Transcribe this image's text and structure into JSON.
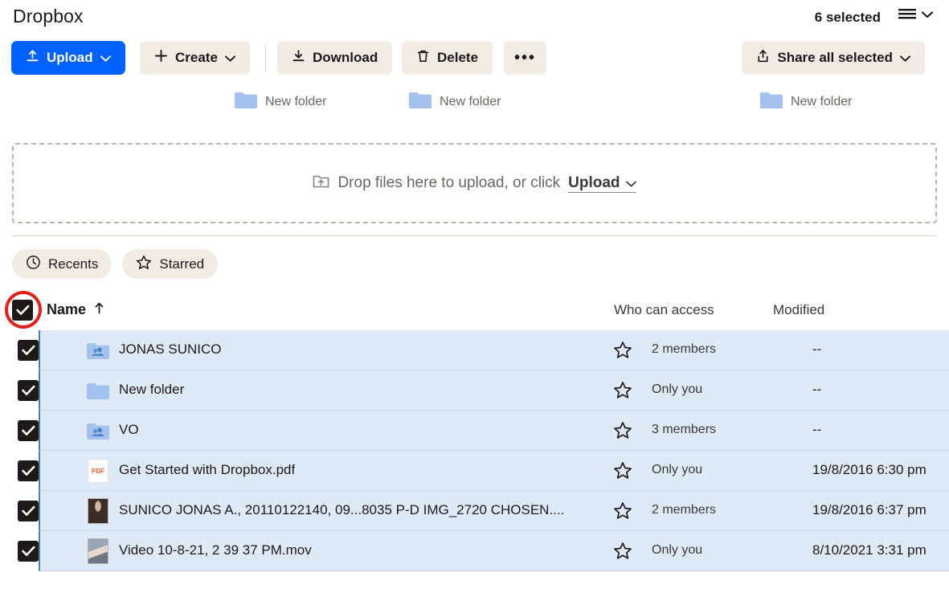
{
  "app": {
    "title": "Dropbox",
    "selected_label": "6 selected",
    "view_icon": "list-view-icon",
    "view_chevron": "chevron-down-icon"
  },
  "toolbar": {
    "upload": {
      "label": "Upload",
      "icon": "upload-icon",
      "chevron": "chevron-down-icon",
      "color": "#0061ff"
    },
    "create": {
      "label": "Create",
      "icon": "plus-icon",
      "chevron": "chevron-down-icon"
    },
    "download": {
      "label": "Download",
      "icon": "download-icon"
    },
    "delete": {
      "label": "Delete",
      "icon": "trash-icon"
    },
    "more": {
      "label": "•••",
      "icon": "ellipsis-icon"
    },
    "share_all": {
      "label": "Share all selected",
      "icon": "share-icon",
      "chevron": "chevron-down-icon"
    }
  },
  "suggestions": [
    {
      "label": "New folder",
      "icon": "folder-icon"
    },
    {
      "label": "New folder",
      "icon": "folder-icon"
    },
    {
      "label": "New folder",
      "icon": "folder-icon"
    }
  ],
  "dropzone": {
    "icon": "upload-folder-icon",
    "text_before": "Drop files here to upload, or click",
    "link_label": "Upload",
    "chevron": "chevron-down-icon"
  },
  "filters": [
    {
      "label": "Recents",
      "icon": "clock-icon"
    },
    {
      "label": "Starred",
      "icon": "star-icon"
    }
  ],
  "table": {
    "select_all_checked": true,
    "headers": {
      "name": "Name",
      "sort_arrow": "arrow-up-icon",
      "access": "Who can access",
      "modified": "Modified"
    },
    "rows": [
      {
        "name": "JONAS SUNICO",
        "icon": "shared-folder-icon",
        "access": "2 members",
        "modified": "--",
        "checked": true,
        "starred": false
      },
      {
        "name": "New folder",
        "icon": "folder-icon",
        "access": "Only you",
        "modified": "--",
        "checked": true,
        "starred": false
      },
      {
        "name": "VO",
        "icon": "shared-folder-icon",
        "access": "3 members",
        "modified": "--",
        "checked": true,
        "starred": false
      },
      {
        "name": "Get Started with Dropbox.pdf",
        "icon": "pdf-file-icon",
        "access": "Only you",
        "modified": "19/8/2016 6:30 pm",
        "checked": true,
        "starred": false
      },
      {
        "name": "SUNICO JONAS A., 20110122140, 09...8035 P-D IMG_2720 CHOSEN....",
        "icon": "photo-thumbnail",
        "access": "2 members",
        "modified": "19/8/2016 6:37 pm",
        "checked": true,
        "starred": false
      },
      {
        "name": "Video 10-8-21, 2 39 37 PM.mov",
        "icon": "video-thumbnail",
        "access": "Only you",
        "modified": "8/10/2021 3:31 pm",
        "checked": true,
        "starred": false
      }
    ]
  },
  "annotation": {
    "target": "select-all-checkbox",
    "shape": "ellipse",
    "color": "#e0201b"
  }
}
